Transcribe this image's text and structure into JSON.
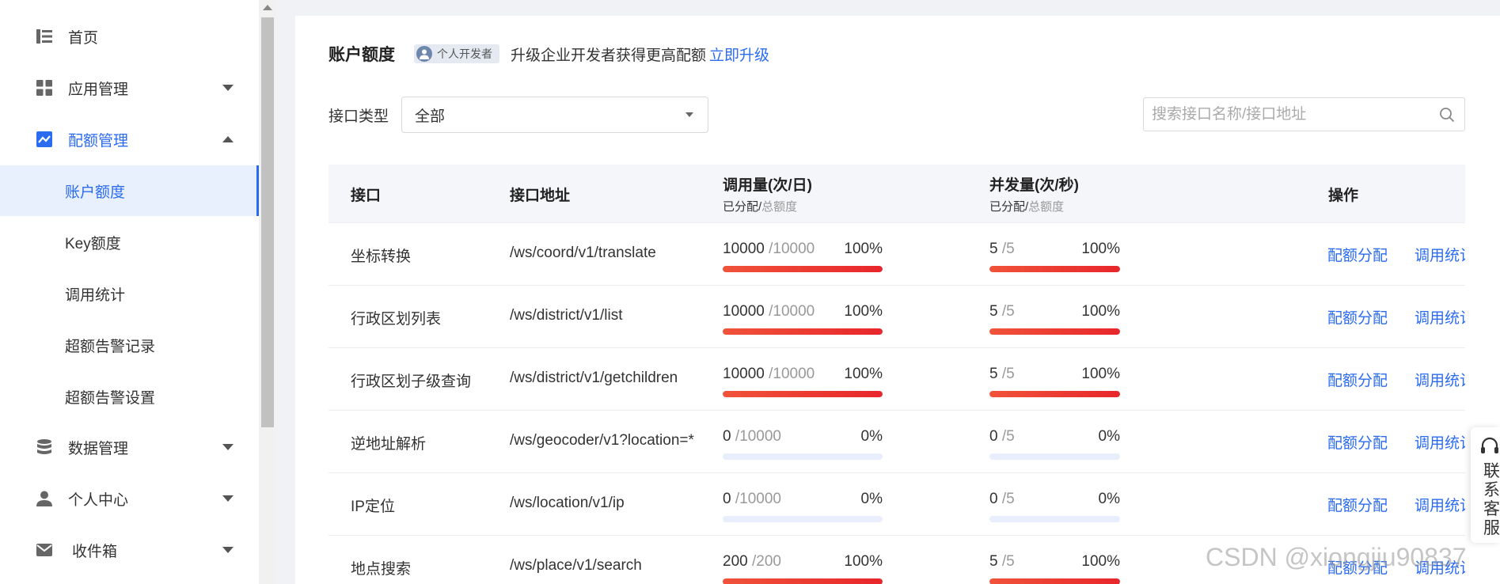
{
  "sidebar": {
    "items": [
      {
        "label": "首页",
        "icon": "home-list-icon"
      },
      {
        "label": "应用管理",
        "icon": "grid-icon"
      },
      {
        "label": "配额管理",
        "icon": "chart-icon"
      },
      {
        "label": "数据管理",
        "icon": "database-icon"
      },
      {
        "label": "个人中心",
        "icon": "user-icon"
      },
      {
        "label": "收件箱",
        "icon": "mail-icon"
      }
    ],
    "sub_items": [
      "账户额度",
      "Key额度",
      "调用统计",
      "超额告警记录",
      "超额告警设置"
    ]
  },
  "header": {
    "title": "账户额度",
    "badge": "个人开发者",
    "upgrade_text": "升级企业开发者获得更高配额",
    "upgrade_link": "立即升级"
  },
  "filter": {
    "label": "接口类型",
    "selected": "全部",
    "search_placeholder": "搜索接口名称/接口地址"
  },
  "table": {
    "columns": {
      "api": "接口",
      "address": "接口地址",
      "calls": "调用量(次/日)",
      "concurrency": "并发量(次/秒)",
      "ops": "操作",
      "sub_allocated": "已分配/",
      "sub_total": "总额度"
    },
    "rows": [
      {
        "name": "坐标转换",
        "address": "/ws/coord/v1/translate",
        "calls_used": "10000",
        "calls_total": "/10000",
        "calls_pct": "100%",
        "calls_ratio": 1.0,
        "conc_used": "5",
        "conc_total": "/5",
        "conc_pct": "100%",
        "conc_ratio": 1.0,
        "op1": "配额分配",
        "op2": "调用统计"
      },
      {
        "name": "行政区划列表",
        "address": "/ws/district/v1/list",
        "calls_used": "10000",
        "calls_total": "/10000",
        "calls_pct": "100%",
        "calls_ratio": 1.0,
        "conc_used": "5",
        "conc_total": "/5",
        "conc_pct": "100%",
        "conc_ratio": 1.0,
        "op1": "配额分配",
        "op2": "调用统计"
      },
      {
        "name": "行政区划子级查询",
        "address": "/ws/district/v1/getchildren",
        "calls_used": "10000",
        "calls_total": "/10000",
        "calls_pct": "100%",
        "calls_ratio": 1.0,
        "conc_used": "5",
        "conc_total": "/5",
        "conc_pct": "100%",
        "conc_ratio": 1.0,
        "op1": "配额分配",
        "op2": "调用统计"
      },
      {
        "name": "逆地址解析",
        "address": "/ws/geocoder/v1?location=*",
        "calls_used": "0",
        "calls_total": "/10000",
        "calls_pct": "0%",
        "calls_ratio": 0,
        "conc_used": "0",
        "conc_total": "/5",
        "conc_pct": "0%",
        "conc_ratio": 0,
        "op1": "配额分配",
        "op2": "调用统计"
      },
      {
        "name": "IP定位",
        "address": "/ws/location/v1/ip",
        "calls_used": "0",
        "calls_total": "/10000",
        "calls_pct": "0%",
        "calls_ratio": 0,
        "conc_used": "0",
        "conc_total": "/5",
        "conc_pct": "0%",
        "conc_ratio": 0,
        "op1": "配额分配",
        "op2": "调用统计"
      },
      {
        "name": "地点搜索",
        "address": "/ws/place/v1/search",
        "calls_used": "200",
        "calls_total": "/200",
        "calls_pct": "100%",
        "calls_ratio": 1.0,
        "conc_used": "5",
        "conc_total": "/5",
        "conc_pct": "100%",
        "conc_ratio": 1.0,
        "op1": "配额分配",
        "op2": "调用统计"
      }
    ]
  },
  "service": {
    "label": "联系客服"
  },
  "watermark": "CSDN @xiongjiu90837",
  "colors": {
    "accent": "#2b6bf0",
    "bar_full": "#e8262b",
    "bar_empty": "#e8eefc"
  }
}
